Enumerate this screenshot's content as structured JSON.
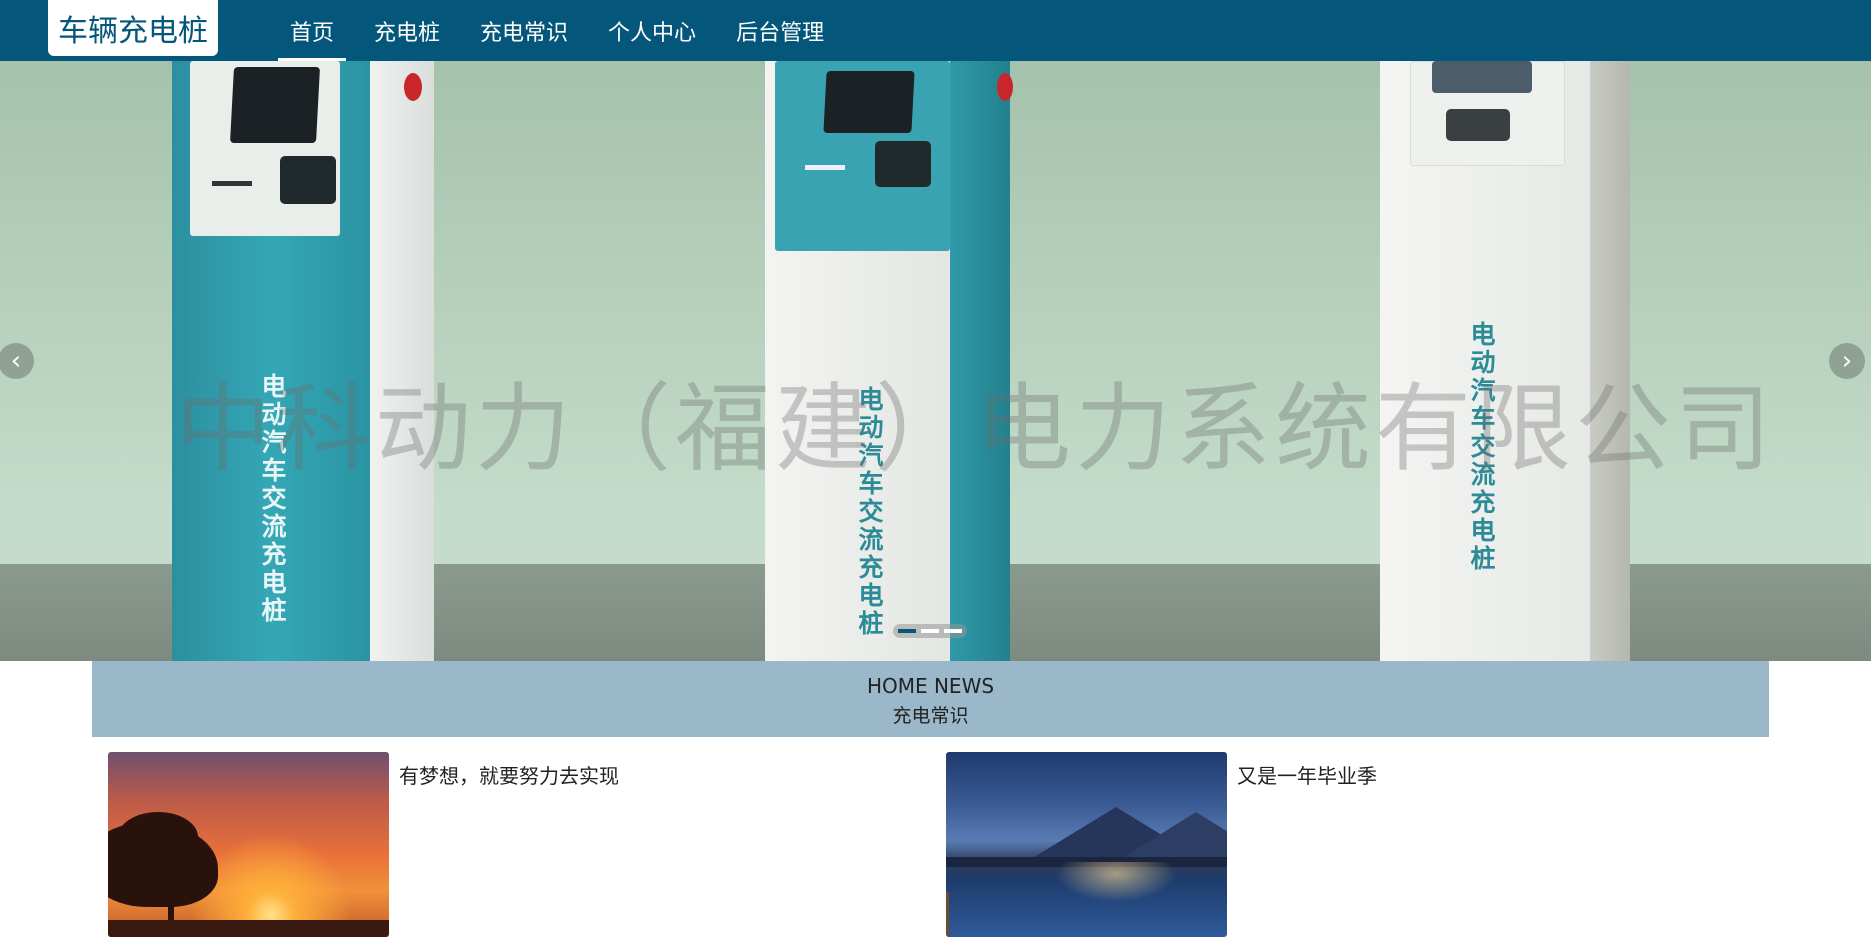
{
  "brand": {
    "logo": "车辆充电桩"
  },
  "nav": {
    "items": [
      {
        "label": "首页",
        "active": true
      },
      {
        "label": "充电桩",
        "active": false
      },
      {
        "label": "充电常识",
        "active": false
      },
      {
        "label": "个人中心",
        "active": false
      },
      {
        "label": "后台管理",
        "active": false
      }
    ]
  },
  "carousel": {
    "pile_text": "电动汽车交流充电桩",
    "watermark": "中科动力（福建）电力系统有限公司",
    "prev_icon": "chevron-left-icon",
    "next_icon": "chevron-right-icon",
    "slide_count": 3,
    "active_slide": 1
  },
  "news": {
    "header_en": "HOME NEWS",
    "header_cn": "充电常识",
    "items": [
      {
        "title": "有梦想，就要努力去实现",
        "image": "sunset-tree-photo"
      },
      {
        "title": "又是一年毕业季",
        "image": "mountain-lake-photo"
      }
    ]
  },
  "colors": {
    "nav_bg": "#04577a",
    "news_header_bg": "#9ab8ca",
    "accent": "#04577a"
  }
}
